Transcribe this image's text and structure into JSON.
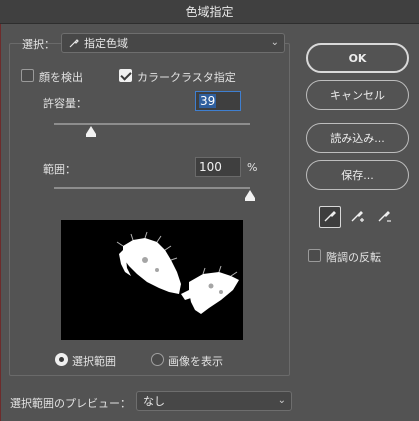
{
  "window": {
    "title": "色域指定"
  },
  "select": {
    "label": "選択：",
    "value": "指定色域"
  },
  "options": {
    "face_detect": {
      "label": "顔を検出",
      "checked": false
    },
    "color_cluster": {
      "label": "カラークラスタ指定",
      "checked": true
    }
  },
  "fuzziness": {
    "label": "許容量：",
    "value": "39",
    "slider_fraction": 0.19
  },
  "range": {
    "label": "範囲：",
    "value": "100",
    "unit": "%",
    "slider_fraction": 1.0
  },
  "view_mode": {
    "selection_label": "選択範囲",
    "image_label": "画像を表示",
    "selected": "selection"
  },
  "preview_select": {
    "label": "選択範囲のプレビュー：",
    "value": "なし"
  },
  "buttons": {
    "ok": "OK",
    "cancel": "キャンセル",
    "load": "読み込み...",
    "save": "保存..."
  },
  "tools": [
    {
      "name": "eyedropper",
      "active": true
    },
    {
      "name": "eyedropper-add",
      "active": false
    },
    {
      "name": "eyedropper-subtract",
      "active": false
    }
  ],
  "invert": {
    "label": "階調の反転",
    "checked": false
  },
  "colors": {
    "panel": "#535353",
    "accent": "#2f5f9e"
  }
}
